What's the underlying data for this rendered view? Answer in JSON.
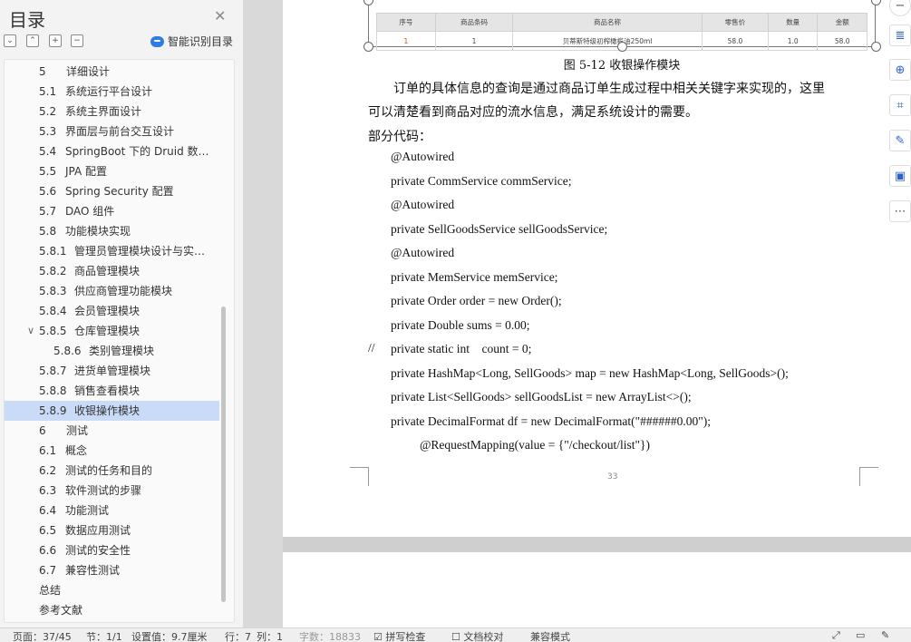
{
  "sidebar": {
    "title": "目录",
    "ai_button": "智能识别目录",
    "items": [
      {
        "num": "5",
        "label": "详细设计",
        "level": 1
      },
      {
        "num": "5.1",
        "label": "系统运行平台设计",
        "level": 2
      },
      {
        "num": "5.2",
        "label": "系统主界面设计",
        "level": 2
      },
      {
        "num": "5.3",
        "label": "界面层与前台交互设计",
        "level": 2
      },
      {
        "num": "5.4",
        "label": "SpringBoot 下的 Druid 数…",
        "level": 2
      },
      {
        "num": "5.5",
        "label": "JPA 配置",
        "level": 2
      },
      {
        "num": "5.6",
        "label": "Spring Security 配置",
        "level": 2
      },
      {
        "num": "5.7",
        "label": "DAO 组件",
        "level": 2
      },
      {
        "num": "5.8",
        "label": "功能模块实现",
        "level": 2
      },
      {
        "num": "5.8.1",
        "label": "管理员管理模块设计与实…",
        "level": 3
      },
      {
        "num": "5.8.2",
        "label": "商品管理模块",
        "level": 3
      },
      {
        "num": "5.8.3",
        "label": "供应商管理功能模块",
        "level": 3
      },
      {
        "num": "5.8.4",
        "label": "会员管理模块",
        "level": 3
      },
      {
        "num": "5.8.5",
        "label": "仓库管理模块",
        "level": 3,
        "expanded": true
      },
      {
        "num": "5.8.6",
        "label": "类别管理模块",
        "level": 4
      },
      {
        "num": "5.8.7",
        "label": "进货单管理模块",
        "level": 3
      },
      {
        "num": "5.8.8",
        "label": "销售查看模块",
        "level": 3
      },
      {
        "num": "5.8.9",
        "label": "收银操作模块",
        "level": 3,
        "active": true
      },
      {
        "num": "6",
        "label": "测试",
        "level": 1
      },
      {
        "num": "6.1",
        "label": "概念",
        "level": 2
      },
      {
        "num": "6.2",
        "label": "测试的任务和目的",
        "level": 2
      },
      {
        "num": "6.3",
        "label": "软件测试的步骤",
        "level": 2
      },
      {
        "num": "6.4",
        "label": "功能测试",
        "level": 2
      },
      {
        "num": "6.5",
        "label": "数据应用测试",
        "level": 2
      },
      {
        "num": "6.6",
        "label": "测试的安全性",
        "level": 2
      },
      {
        "num": "6.7",
        "label": "兼容性测试",
        "level": 2
      },
      {
        "num": "",
        "label": "总结",
        "level": 1
      },
      {
        "num": "",
        "label": "参考文献",
        "level": 1
      }
    ]
  },
  "figure": {
    "headers": [
      "序号",
      "商品条码",
      "商品名称",
      "零售价",
      "数量",
      "金额"
    ],
    "row": [
      "1",
      "1",
      "贝蒂斯特级初榨橄榄油250ml",
      "58.0",
      "1.0",
      "58.0"
    ],
    "caption": "图 5-12  收银操作模块"
  },
  "document": {
    "para1_line1": "订单的具体信息的查询是通过商品订单生成过程中相关关键字来实现的，这里",
    "para1_line2": "可以清楚看到商品对应的流水信息，满足系统设计的需要。",
    "para2": "部分代码：",
    "code": [
      "@Autowired",
      "private CommService commService;",
      "@Autowired",
      "private SellGoodsService sellGoodsService;",
      "@Autowired",
      "private MemService memService;",
      "private Order order = new Order();",
      "private Double sums = 0.00;",
      "private static int    count = 0;",
      "private HashMap<Long, SellGoods> map = new HashMap<Long, SellGoods>();",
      "private List<SellGoods> sellGoodsList = new ArrayList<>();",
      "private DecimalFormat df = new DecimalFormat(\"######0.00\");",
      "@RequestMapping(value = {\"/checkout/list\"})"
    ],
    "comment_mark": "//",
    "page_number": "33"
  },
  "statusbar": {
    "page": "页面：37/45",
    "section": "节：1/1",
    "setting": "设置值：9.7厘米",
    "row": "行：7",
    "col": "列：1",
    "words": "字数：18833",
    "spell": "拼写检查",
    "proofread": "文档校对",
    "mode": "兼容模式"
  },
  "right_toolbar": [
    "minus-icon",
    "text-icon",
    "zoom-icon",
    "crop-icon",
    "edit-icon",
    "image-icon",
    "more-icon"
  ],
  "colors": {
    "active_toc": "#c9dbf7",
    "accent": "#2f7de1",
    "caption_red": "#d43"
  }
}
